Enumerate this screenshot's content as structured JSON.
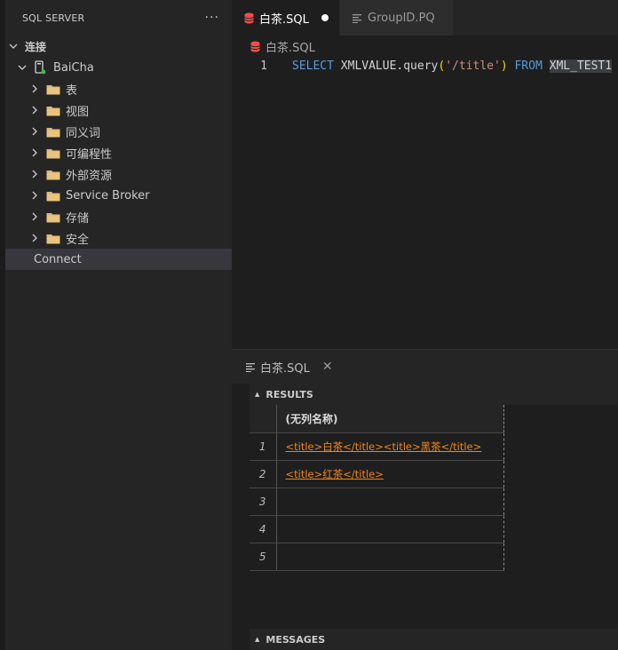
{
  "sidebar": {
    "title": "SQL SERVER",
    "more": "···",
    "connections_label": "连接",
    "server": "BaiCha",
    "folders": [
      "表",
      "视图",
      "同义词",
      "可编程性",
      "外部资源",
      "Service Broker",
      "存储",
      "安全"
    ],
    "connect_item": "Connect"
  },
  "editor": {
    "tabs": [
      {
        "label": "白茶.SQL",
        "icon": "database-icon",
        "modified": true
      },
      {
        "label": "GroupID.PQ",
        "icon": "lines-icon",
        "modified": false
      }
    ],
    "breadcrumb": "白茶.SQL",
    "line_number": "1",
    "code": {
      "select": "SELECT",
      "func": " XMLVALUE.query",
      "open": "(",
      "arg": "'/title'",
      "close": ")",
      "from": " FROM",
      "table": "XML_TEST1"
    }
  },
  "results_panel": {
    "tab_label": "白茶.SQL",
    "close": "✕",
    "results_header": "RESULTS",
    "messages_header": "MESSAGES",
    "column_header": "(无列名称)",
    "rows": [
      {
        "n": "1",
        "value": "<title>白茶</title><title>黑茶</title>"
      },
      {
        "n": "2",
        "value": "<title>红茶</title>"
      },
      {
        "n": "3",
        "value": ""
      },
      {
        "n": "4",
        "value": ""
      },
      {
        "n": "5",
        "value": ""
      }
    ]
  },
  "colors": {
    "keyword": "#569cd6",
    "string": "#ce9178",
    "link": "#f38518",
    "database_icon": "#f14c4c"
  }
}
